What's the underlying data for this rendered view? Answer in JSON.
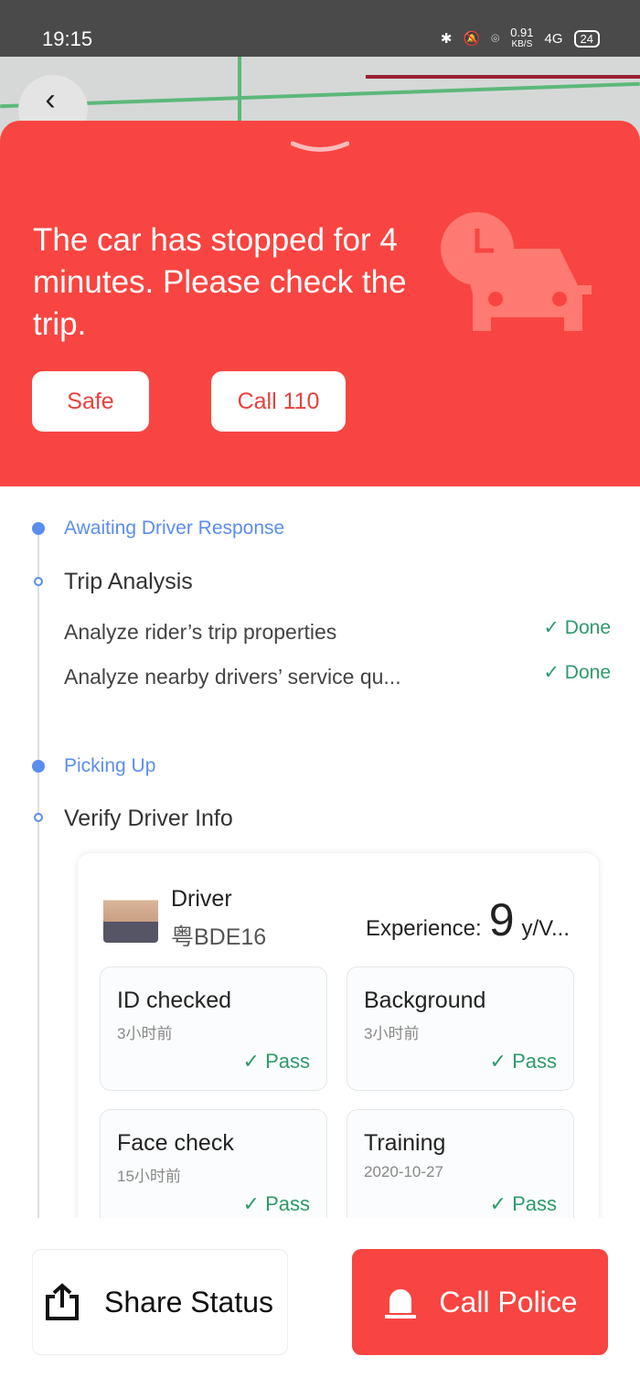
{
  "status_bar": {
    "time": "19:15",
    "speed": "0.91",
    "speed_unit": "KB/S",
    "network": "4G",
    "battery": "24"
  },
  "alert": {
    "message": "The car has stopped for 4 minutes. Please check the trip.",
    "safe_label": "Safe",
    "call_label": "Call 110",
    "color": "#f84541"
  },
  "timeline": {
    "stage1": "Awaiting Driver Response",
    "trip_analysis": {
      "title": "Trip Analysis",
      "items": [
        {
          "label": "Analyze rider’s trip properties",
          "status": "Done"
        },
        {
          "label": "Analyze nearby drivers’ service qu...",
          "status": "Done"
        }
      ]
    },
    "stage2": "Picking Up",
    "verify": {
      "title": "Verify Driver Info"
    }
  },
  "driver": {
    "name": "Driver",
    "plate": "粤BDE16",
    "experience_label": "Experience:",
    "experience_value": "9",
    "experience_unit": "y/V...",
    "checks": [
      {
        "title": "ID checked",
        "time": "3小时前",
        "status": "Pass"
      },
      {
        "title": "Background",
        "time": "3小时前",
        "status": "Pass"
      },
      {
        "title": "Face check",
        "time": "15小时前",
        "status": "Pass"
      },
      {
        "title": "Training",
        "time": "2020-10-27",
        "status": "Pass"
      }
    ]
  },
  "actions": {
    "share": "Share Status",
    "police": "Call Police"
  }
}
